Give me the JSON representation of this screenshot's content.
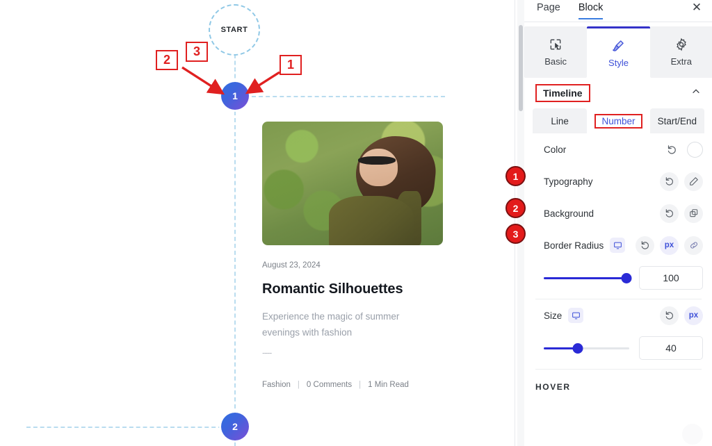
{
  "canvas": {
    "start_label": "START",
    "nodes": [
      {
        "label": "1"
      },
      {
        "label": "2"
      }
    ],
    "post": {
      "date": "August 23, 2024",
      "title": "Romantic Silhouettes",
      "excerpt": "Experience the magic of summer evenings with fashion",
      "dashes": "----",
      "meta": {
        "category": "Fashion",
        "comments": "0 Comments",
        "read_time": "1 Min Read",
        "separator": "|"
      },
      "image_alt": "woman-with-sunglasses-photo"
    },
    "annotations": [
      {
        "label": "1"
      },
      {
        "label": "2"
      },
      {
        "label": "3"
      }
    ]
  },
  "panel": {
    "header": {
      "tabs": [
        {
          "label": "Page",
          "active": false
        },
        {
          "label": "Block",
          "active": true
        }
      ],
      "close_icon": "close-icon",
      "close_glyph": "✕"
    },
    "segments": [
      {
        "label": "Basic",
        "icon": "cursor-select-icon",
        "active": false
      },
      {
        "label": "Style",
        "icon": "paintbrush-icon",
        "active": true
      },
      {
        "label": "Extra",
        "icon": "gear-icon",
        "active": false
      }
    ],
    "section": {
      "title": "Timeline",
      "collapse_icon": "chevron-up-icon"
    },
    "subtabs": [
      {
        "label": "Line",
        "active": false
      },
      {
        "label": "Number",
        "active": true
      },
      {
        "label": "Start/End",
        "active": false
      }
    ],
    "options": [
      {
        "label": "Color",
        "reset_icon": "reset-icon",
        "control_icon": "color-swatch-icon"
      },
      {
        "label": "Typography",
        "reset_icon": "reset-icon",
        "control_icon": "pencil-edit-icon"
      },
      {
        "label": "Background",
        "reset_icon": "reset-icon",
        "control_icon": "copy-layers-icon"
      }
    ],
    "border_radius": {
      "label": "Border Radius",
      "device_icon": "desktop-icon",
      "reset_icon": "reset-icon",
      "unit": "px",
      "link_icon": "link-icon",
      "value": "100",
      "slider_percent": 97
    },
    "size": {
      "label": "Size",
      "device_icon": "desktop-icon",
      "reset_icon": "reset-icon",
      "unit": "px",
      "value": "40",
      "slider_percent": 40
    },
    "hover_label": "HOVER",
    "bullets": [
      {
        "label": "1"
      },
      {
        "label": "2"
      },
      {
        "label": "3"
      }
    ]
  },
  "colors": {
    "accent_blue": "#3f51d8",
    "slider_blue": "#2a2ad6",
    "annotation_red": "#e02020",
    "bullet_red": "#e31b1b",
    "node_gradient_start": "#2f6fe0",
    "node_gradient_end": "#7b4fd6",
    "dashed_line": "#b9dcef"
  }
}
